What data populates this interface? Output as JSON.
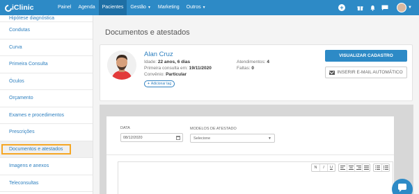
{
  "brand": {
    "name": "iClinic"
  },
  "nav": {
    "items": [
      {
        "label": "Painel",
        "active": false,
        "caret": false
      },
      {
        "label": "Agenda",
        "active": false,
        "caret": false
      },
      {
        "label": "Pacientes",
        "active": true,
        "caret": false
      },
      {
        "label": "Gestão",
        "active": false,
        "caret": true
      },
      {
        "label": "Marketing",
        "active": false,
        "caret": false
      },
      {
        "label": "Outros",
        "active": false,
        "caret": true
      }
    ],
    "caret_glyph": "▼"
  },
  "top_icons": [
    "plus-circle-icon",
    "gift-icon",
    "bell-icon",
    "chat-icon",
    "avatar",
    "chevron-down-icon"
  ],
  "sidebar": {
    "items": [
      {
        "label": "Hipótese diagnóstica",
        "active": false,
        "cut": true
      },
      {
        "label": "Condutas",
        "active": false
      },
      {
        "label": "Curva",
        "active": false
      },
      {
        "label": "Primeira Consulta",
        "active": false
      },
      {
        "label": "Óculos",
        "active": false
      },
      {
        "label": "Orçamento",
        "active": false
      },
      {
        "label": "Exames e procedimentos",
        "active": false
      },
      {
        "label": "Prescrições",
        "active": false
      },
      {
        "label": "Documentos e atestados",
        "active": true
      },
      {
        "label": "Imagens e anexos",
        "active": false
      },
      {
        "label": "Teleconsultas",
        "active": false
      }
    ]
  },
  "page": {
    "title": "Documentos e atestados"
  },
  "patient": {
    "name": "Alan Cruz",
    "age_label": "Idade:",
    "age_value": "22 anos, 6 dias",
    "first_visit_label": "Primeira consulta em:",
    "first_visit_value": "19/11/2020",
    "plan_label": "Convênio:",
    "plan_value": "Particular",
    "add_tag": "Adicionar tag",
    "appointments_label": "Atendimentos:",
    "appointments_value": "4",
    "absences_label": "Faltas:",
    "absences_value": "0",
    "view_button": "VISUALIZAR CADASTRO",
    "email_button": "INSERIR E-MAIL AUTOMÁTICO"
  },
  "form": {
    "date_label": "DATA",
    "date_value": "08/12/2020",
    "template_label": "MODELOS DE ATESTADO",
    "template_value": "Selecione"
  },
  "editor": {
    "toolbar_groups": [
      [
        "N",
        "I",
        "U"
      ],
      [
        "align-left-icon",
        "align-center-icon",
        "align-right-icon",
        "align-justify-icon"
      ],
      [
        "list-bullet-icon",
        "list-number-icon"
      ]
    ]
  },
  "colors": {
    "brand": "#2d8ac6",
    "highlight": "#f5a623"
  }
}
